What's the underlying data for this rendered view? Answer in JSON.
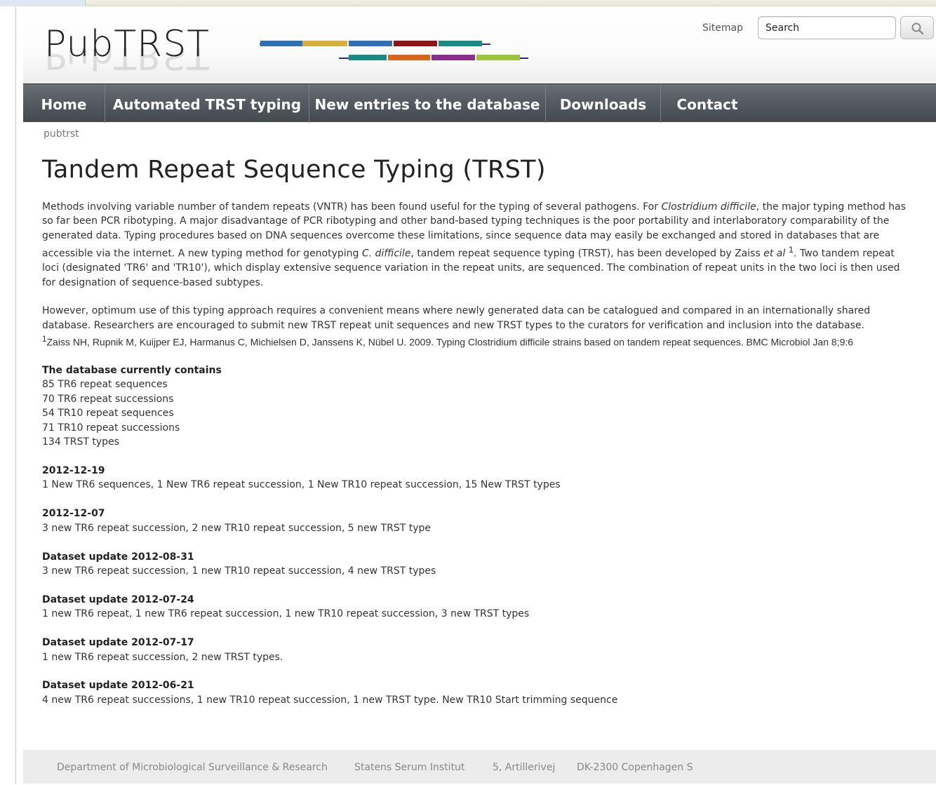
{
  "header": {
    "logo": "PubTRST",
    "sitemap": "Sitemap",
    "search_placeholder": "Search",
    "search_value": "Search"
  },
  "nav": {
    "items": [
      {
        "label": "Home"
      },
      {
        "label": "Automated TRST typing"
      },
      {
        "label": "New entries to the database"
      },
      {
        "label": "Downloads"
      },
      {
        "label": "Contact"
      }
    ]
  },
  "breadcrumb": "pubtrst",
  "title": "Tandem Repeat Sequence Typing (TRST)",
  "intro": {
    "p1_a": "Methods involving variable number of tandem repeats (VNTR) has been found useful for the typing of several pathogens. For ",
    "p1_b": "Clostridium difficile",
    "p1_c": ", the major typing method has so far been PCR ribotyping. A major disadvantage of PCR ribotyping and other band-based typing techniques is the poor portability and interlaboratory comparability of the generated data. Typing procedures based on DNA sequences overcome these limitations, since sequence data may easily be exchanged and stored in databases that are accessible via the internet. A new typing method for genotyping ",
    "p1_d": "C. difficile",
    "p1_e": ", tandem repeat sequence typing (TRST), has been developed by Zaiss ",
    "p1_f": "et al",
    "p1_g": "1",
    "p1_h": ". Two tandem repeat loci (designated 'TR6' and 'TR10'), which display extensive sequence variation in the repeat units, are sequenced. The combination of repeat units in the two loci is then used for designation of sequence-based subtypes.",
    "p2": "However, optimum use of this typing approach requires a convenient means where newly generated data can be catalogued and compared in an internationally shared database. Researchers are encouraged to submit new TRST repeat unit sequences and new TRST types to the curators for verification and inclusion into the database.",
    "ref_mark": "1",
    "ref": "Zaiss NH, Rupnik M, Kuijper EJ, Harmanus C, Michielsen D, Janssens K, Nübel U. 2009. Typing Clostridium difficile strains based on tandem repeat sequences. BMC Microbiol Jan 8;9:6"
  },
  "database": {
    "title": "The database currently contains",
    "lines": [
      "85 TR6 repeat sequences",
      "70 TR6 repeat successions",
      "54 TR10 repeat sequences",
      "71 TR10 repeat successions",
      "134 TRST types"
    ]
  },
  "updates": [
    {
      "title": "2012-12-19",
      "text": "1 New TR6 sequences, 1 New TR6 repeat succession, 1 New TR10 repeat succession, 15 New TRST types"
    },
    {
      "title": "2012-12-07",
      "text": "3 new TR6 repeat succession, 2 new TR10 repeat succession, 5 new TRST type"
    },
    {
      "title": "Dataset update 2012-08-31",
      "text": "3 new TR6 repeat succession, 1 new TR10 repeat succession, 4 new TRST types"
    },
    {
      "title": "Dataset update 2012-07-24",
      "text": "1 new TR6 repeat, 1 new TR6 repeat succession, 1 new TR10 repeat succession, 3 new TRST types"
    },
    {
      "title": "Dataset update 2012-07-17",
      "text": "1 new TR6 repeat succession, 2 new TRST types."
    },
    {
      "title": "Dataset update 2012-06-21",
      "text": "4 new TR6 repeat successions, 1 new TR10 repeat succession, 1 new TRST type. New TR10 Start trimming sequence"
    }
  ],
  "footer": {
    "department": "Department of Microbiological Surveillance & Research",
    "institute": "Statens Serum Institut",
    "street": "5, Artillerivej",
    "city": "DK-2300 Copenhagen S"
  },
  "colors": {
    "nav": "#55595f",
    "logo_blue": "#2f6fb3",
    "logo_yellow": "#d4b23a",
    "logo_red": "#8e1414",
    "logo_teal": "#1a8a84",
    "logo_orange": "#d9651d",
    "logo_purple": "#8a2e8c",
    "logo_green": "#9cc43a"
  }
}
